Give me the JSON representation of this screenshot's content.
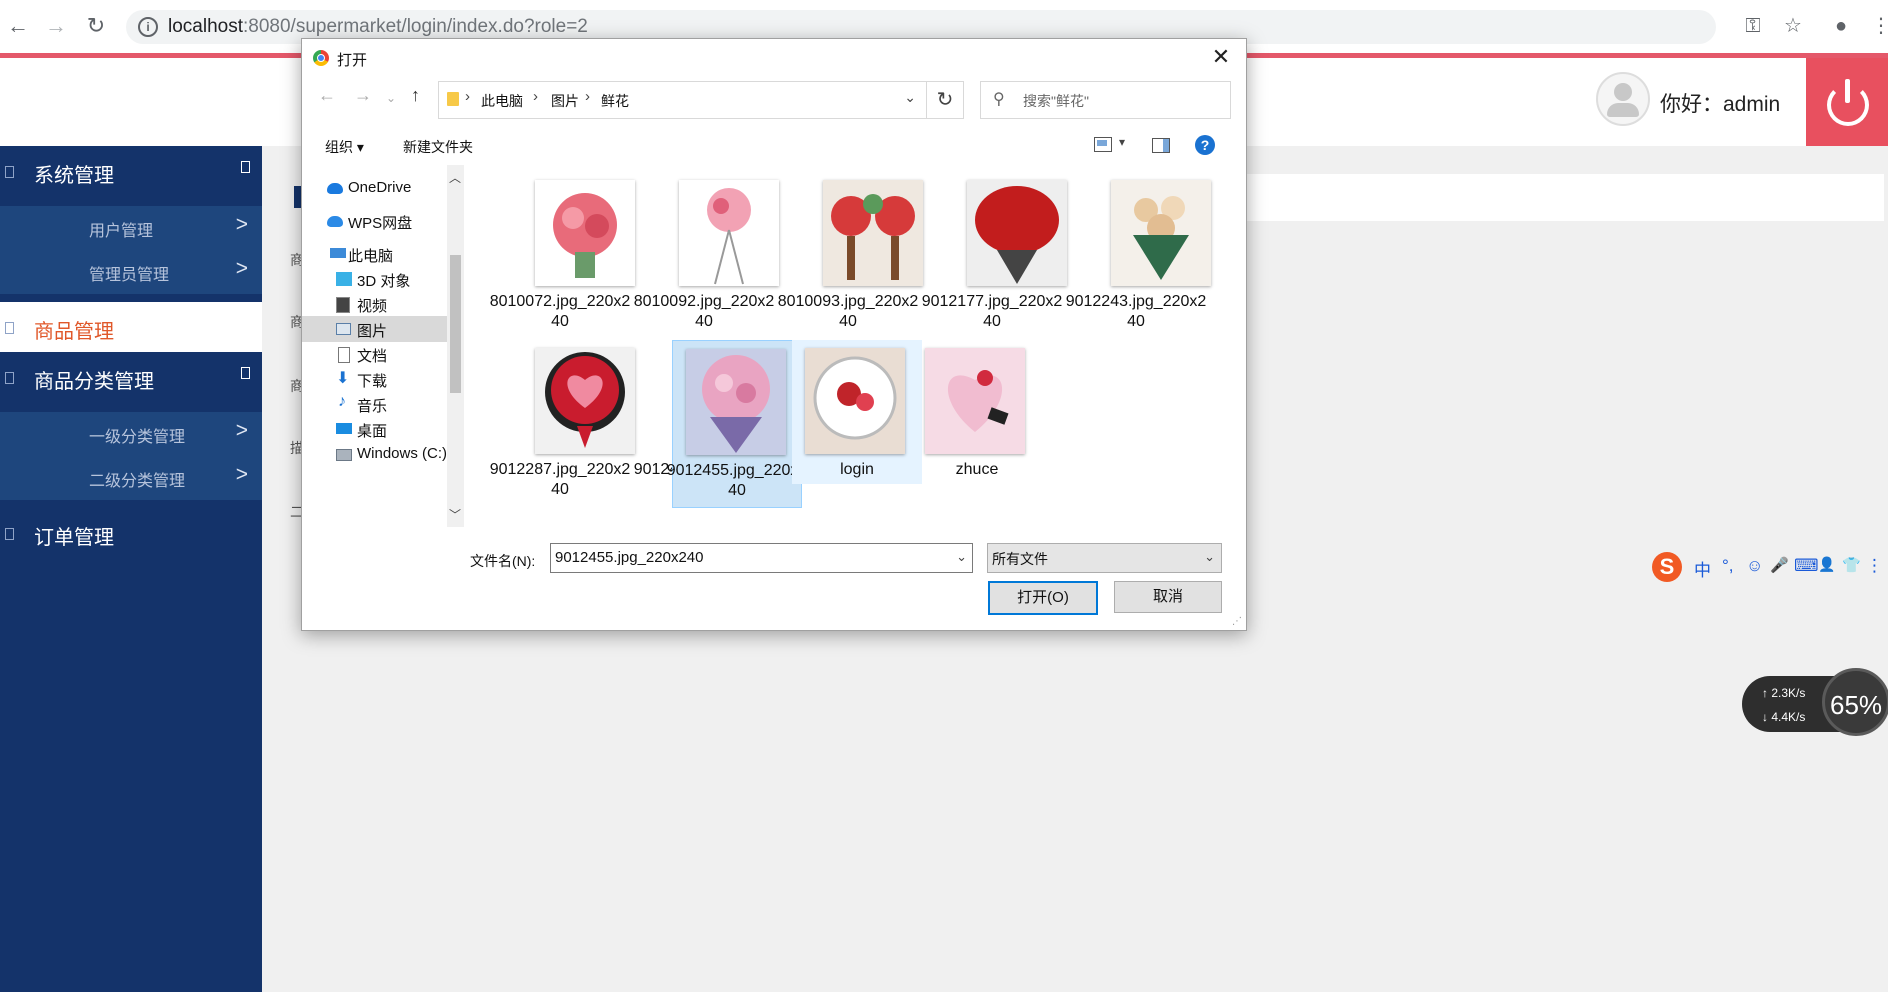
{
  "browser": {
    "url_host": "localhost",
    "url_rest": ":8080/supermarket/login/index.do?role=2",
    "back_icon": "arrow-left-icon",
    "forward_icon": "arrow-right-icon",
    "reload_icon": "reload-icon"
  },
  "header": {
    "greeting": "你好：admin"
  },
  "sidebar": {
    "groups": [
      {
        "label": "系统管理",
        "items": [
          {
            "label": "用户管理"
          },
          {
            "label": "管理员管理"
          }
        ]
      },
      {
        "label": "商品管理"
      },
      {
        "label": "商品分类管理",
        "items": [
          {
            "label": "一级分类管理"
          },
          {
            "label": "二级分类管理"
          }
        ]
      },
      {
        "label": "订单管理"
      }
    ],
    "arrow": ">",
    "active_color": "#e0582a"
  },
  "content": {
    "row_chars": [
      "商",
      "商",
      "商",
      "描",
      "二"
    ]
  },
  "dialog": {
    "title": "打开",
    "close": "✕",
    "breadcrumb": [
      "此电脑",
      "图片",
      "鲜花"
    ],
    "search_placeholder": "搜索\"鲜花\"",
    "toolbar": {
      "organize": "组织 ▾",
      "new_folder": "新建文件夹",
      "help": "?"
    },
    "nav": [
      {
        "label": "OneDrive"
      },
      {
        "label": "WPS网盘"
      },
      {
        "label": "此电脑"
      },
      {
        "label": "3D 对象"
      },
      {
        "label": "视频"
      },
      {
        "label": "图片"
      },
      {
        "label": "文档"
      },
      {
        "label": "下载"
      },
      {
        "label": "音乐"
      },
      {
        "label": "桌面"
      },
      {
        "label": "Windows (C:)"
      }
    ],
    "files": [
      {
        "name": "8010072.jpg_220x240",
        "color": "#e86b7a"
      },
      {
        "name": "8010092.jpg_220x240",
        "color": "#f2a2b4"
      },
      {
        "name": "8010093.jpg_220x240",
        "color": "#d63a3a"
      },
      {
        "name": "9012177.jpg_220x240",
        "color": "#c21d1d"
      },
      {
        "name": "9012243.jpg_220x240",
        "color": "#e8c9a0"
      },
      {
        "name": "9012287.jpg_220x240",
        "color": "#e83850"
      },
      {
        "name": "9012450.jpg_220x240",
        "color": "#b7252c"
      },
      {
        "name": "9012455.jpg_220x240",
        "color": "#e9a4c2"
      },
      {
        "name": "login",
        "color": "#d9c3b6"
      },
      {
        "name": "zhuce",
        "color": "#f1bcd0"
      }
    ],
    "filename_label": "文件名(N):",
    "filename_value": "9012455.jpg_220x240",
    "filetype": "所有文件",
    "open_button": "打开(O)",
    "cancel_button": "取消"
  },
  "ime": {
    "logo": "S",
    "items": [
      "中",
      "°,",
      "☺",
      "🎤",
      "⌨",
      "👤",
      "👕",
      "⋮"
    ]
  },
  "network": {
    "up": "2.3K/s",
    "down": "4.4K/s",
    "percent": "65%"
  }
}
